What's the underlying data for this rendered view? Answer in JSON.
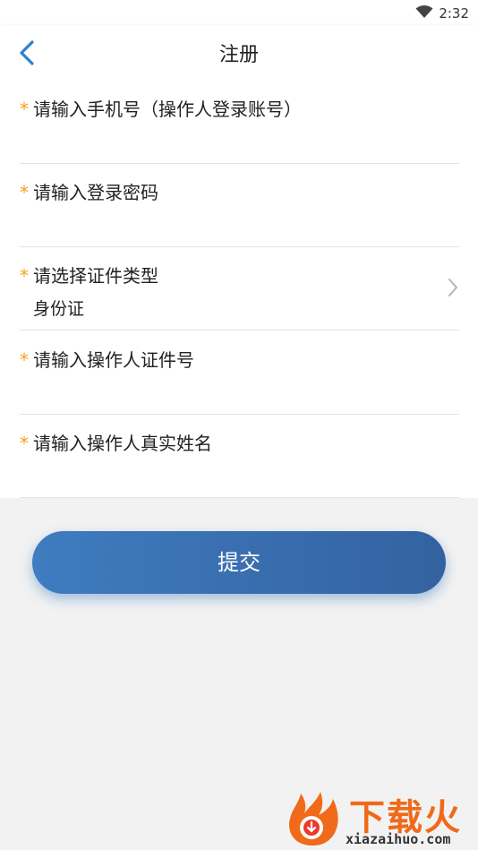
{
  "status_bar": {
    "time": "2:32",
    "wifi_icon": "wifi-icon"
  },
  "header": {
    "title": "注册",
    "back_icon": "chevron-left-icon"
  },
  "form": {
    "required_mark": "*",
    "fields": [
      {
        "label": "请输入手机号（操作人登录账号）",
        "value": ""
      },
      {
        "label": "请输入登录密码",
        "value": ""
      },
      {
        "label": "请选择证件类型",
        "value": "身份证"
      },
      {
        "label": "请输入操作人证件号",
        "value": ""
      },
      {
        "label": "请输入操作人真实姓名",
        "value": ""
      }
    ]
  },
  "submit_label": "提交",
  "watermark": {
    "title": "下载火",
    "url": "xiazaihuo.com"
  },
  "colors": {
    "accent": "#3f7cc0",
    "required": "#f5a11b",
    "back_arrow": "#2f7fd6"
  }
}
